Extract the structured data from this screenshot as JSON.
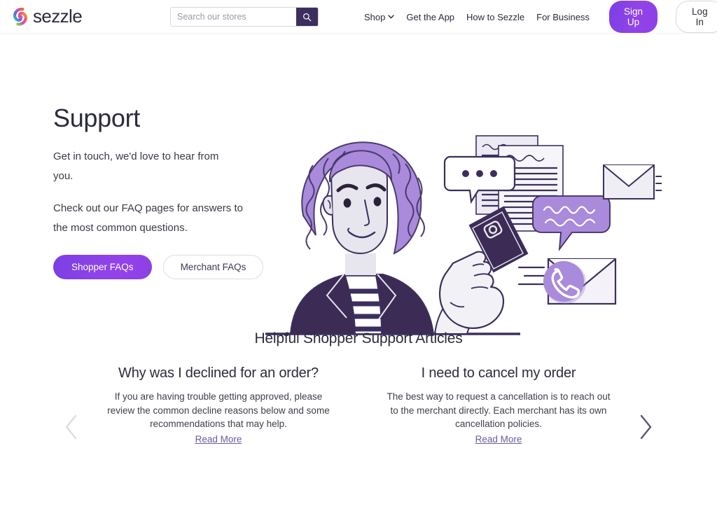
{
  "header": {
    "logo_text": "sezzle",
    "logo_icon": "sezzle-swirl-logo",
    "search": {
      "placeholder": "Search our stores",
      "value": "",
      "icon": "search-icon"
    },
    "nav": [
      {
        "label": "Shop",
        "icon": "chevron-down-icon",
        "has_chevron": true
      },
      {
        "label": "Get the App",
        "has_chevron": false
      },
      {
        "label": "How to Sezzle",
        "has_chevron": false
      },
      {
        "label": "For Business",
        "has_chevron": false
      }
    ],
    "signup_label": "Sign Up",
    "login_label": "Log In"
  },
  "hero": {
    "title": "Support",
    "paragraph1": "Get in touch, we'd love to hear from you.",
    "paragraph2": "Check out our FAQ pages for answers to the most common questions.",
    "primary_button": "Shopper FAQs",
    "secondary_button": "Merchant FAQs",
    "illustration_name": "customer-support-illustration"
  },
  "articles": {
    "section_title": "Helpful Shopper Support Articles",
    "prev_icon": "chevron-left-icon",
    "next_icon": "chevron-right-icon",
    "cards": [
      {
        "title": "Why was I declined for an order?",
        "body": "If you are having trouble getting approved, please review the common decline reasons below and some recommendations that may help.",
        "link": "Read More"
      },
      {
        "title": "I need to cancel my order",
        "body": "The best way to request a cancellation is to reach out to the merchant directly. Each merchant has its own cancellation policies.",
        "link": "Read More"
      }
    ]
  },
  "colors": {
    "brand_purple": "#8e3fe6",
    "dark_purple": "#3c2f5e",
    "light_purple": "#a98adb",
    "text_dark": "#2b2b3d",
    "link_purple": "#6c5b9e",
    "arrow_inactive": "#dcdce2",
    "arrow_active": "#5b5476"
  }
}
